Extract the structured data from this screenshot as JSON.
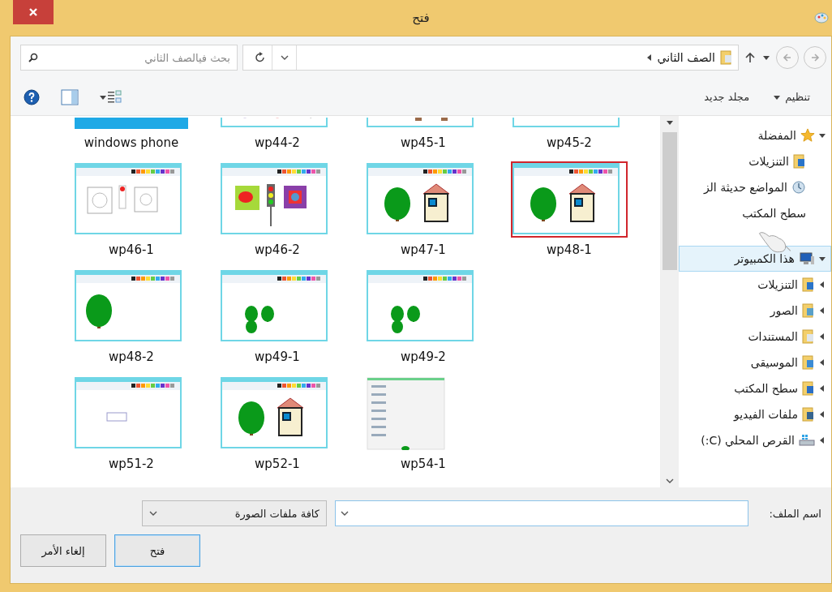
{
  "window": {
    "title": "فتح"
  },
  "address_bar": {
    "path": "الصف الثاني"
  },
  "search": {
    "placeholder": "بحث فيالصف الثاني"
  },
  "toolbar": {
    "organize": "تنظيم",
    "new_folder": "مجلد جديد"
  },
  "navigation": [
    {
      "label": "المفضلة",
      "kind": "star",
      "expanded": true,
      "selected": false,
      "children": [
        {
          "label": "التنزيلات",
          "kind": "downloads",
          "selected": false
        },
        {
          "label": "المواضع حديثة الز",
          "kind": "recent",
          "selected": false
        },
        {
          "label": "سطح المكتب",
          "kind": "none",
          "selected": false
        }
      ]
    },
    {
      "label": "هذا الكمبيوتر",
      "kind": "computer",
      "expanded": true,
      "selected": true,
      "children": [
        {
          "label": "التنزيلات",
          "kind": "downloads",
          "selected": false
        },
        {
          "label": "الصور",
          "kind": "pictures",
          "selected": false
        },
        {
          "label": "المستندات",
          "kind": "documents",
          "selected": false
        },
        {
          "label": "الموسيقى",
          "kind": "music",
          "selected": false
        },
        {
          "label": "سطح المكتب",
          "kind": "desktop",
          "selected": false
        },
        {
          "label": "ملفات الفيديو",
          "kind": "videos",
          "selected": false
        },
        {
          "label": "القرص المحلي (C:)",
          "kind": "disk",
          "selected": false
        }
      ]
    }
  ],
  "file_rows": [
    [
      {
        "name": "wp45-2",
        "kind": "blank",
        "selected": false
      },
      {
        "name": "wp45-1",
        "kind": "house",
        "selected": false
      },
      {
        "name": "wp44-2",
        "kind": "shapes",
        "selected": false
      },
      {
        "name": "windows phone",
        "kind": "blue",
        "selected": false
      }
    ],
    [
      {
        "name": "wp48-1",
        "kind": "tree-house",
        "selected": true
      },
      {
        "name": "wp47-1",
        "kind": "tree-house",
        "selected": false
      },
      {
        "name": "wp46-2",
        "kind": "traffic",
        "selected": false
      },
      {
        "name": "wp46-1",
        "kind": "outline",
        "selected": false
      }
    ],
    [
      {
        "name": "wp49-2",
        "kind": "trees",
        "selected": false
      },
      {
        "name": "wp49-1",
        "kind": "trees",
        "selected": false
      },
      {
        "name": "wp48-2",
        "kind": "tree",
        "selected": false
      }
    ],
    [
      {
        "name": "wp54-1",
        "kind": "menu",
        "selected": false
      },
      {
        "name": "wp52-1",
        "kind": "tree-house",
        "selected": false
      },
      {
        "name": "wp51-2",
        "kind": "blank",
        "selected": false
      }
    ]
  ],
  "footer": {
    "file_name_label": "اسم الملف:",
    "file_type": "كافة ملفات الصورة",
    "buttons": [
      {
        "label": "فتح",
        "default": true
      },
      {
        "label": "إلغاء الأمر",
        "default": false
      }
    ]
  }
}
